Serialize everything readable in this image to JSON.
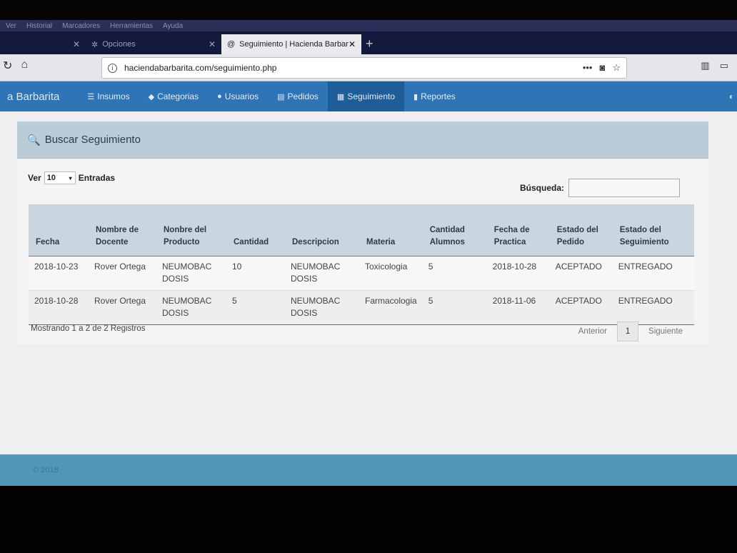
{
  "browser": {
    "menu": [
      "Ver",
      "Historial",
      "Marcadores",
      "Herramientas",
      "Ayuda"
    ],
    "tabs": [
      {
        "label": ""
      },
      {
        "label": "Opciones"
      },
      {
        "label": "Seguimiento | Hacienda Barbar"
      }
    ],
    "url": "haciendabarbarita.com/seguimiento.php"
  },
  "site": {
    "brand": "a Barbarita",
    "nav": [
      {
        "label": "Insumos",
        "icon": "list-icon"
      },
      {
        "label": "Categorias",
        "icon": "tag-icon"
      },
      {
        "label": "Usuarios",
        "icon": "user-icon"
      },
      {
        "label": "Pedidos",
        "icon": "document-icon"
      },
      {
        "label": "Seguimiento",
        "icon": "table-icon",
        "active": true
      },
      {
        "label": "Reportes",
        "icon": "file-icon"
      }
    ]
  },
  "panel": {
    "title": "Buscar Seguimiento",
    "ver_label": "Ver",
    "entries_value": "10",
    "entries_label": "Entradas",
    "search_label": "Búsqueda:",
    "search_value": ""
  },
  "table": {
    "headers": [
      "Fecha",
      "Nombre de Docente",
      "Nonbre del Producto",
      "Cantidad",
      "Descripcion",
      "Materia",
      "Cantidad Alumnos",
      "Fecha de Practica",
      "Estado del Pedido",
      "Estado del Seguimiento"
    ],
    "rows": [
      [
        "2018-10-23",
        "Rover Ortega",
        "NEUMOBAC DOSIS",
        "10",
        "NEUMOBAC DOSIS",
        "Toxicologia",
        "5",
        "2018-10-28",
        "ACEPTADO",
        "ENTREGADO"
      ],
      [
        "2018-10-28",
        "Rover Ortega",
        "NEUMOBAC DOSIS",
        "5",
        "NEUMOBAC DOSIS",
        "Farmacologia",
        "5",
        "2018-11-06",
        "ACEPTADO",
        "ENTREGADO"
      ]
    ]
  },
  "pagination": {
    "showing": "Mostrando 1 a 2 de 2 Registros",
    "prev": "Anterior",
    "page": "1",
    "next": "Siguiente"
  },
  "footer": {
    "text": "© 2018"
  },
  "colors": {
    "nav": "#2f74b5",
    "footer": "#4f97b5",
    "panel_head": "#b9ccd8"
  }
}
